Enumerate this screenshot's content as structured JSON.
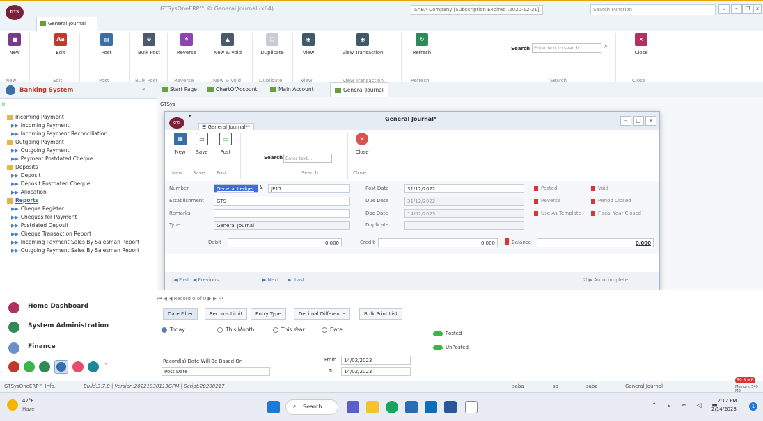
{
  "window": {
    "app_title": "GTSysOneERP™ © General Journal (x64)",
    "company": "SABA Company [Subscription Expired :2020-12-31]",
    "search_function_placeholder": "Search Function",
    "logo_text": "GTS",
    "doc_tab": "General Journal"
  },
  "ribbon": {
    "buttons": [
      {
        "label": "New",
        "group": "New",
        "color": "#7a3a8a"
      },
      {
        "label": "Edit",
        "group": "Edit",
        "color": "#c0392b"
      },
      {
        "label": "Post",
        "group": "Post",
        "color": "#3a6ea5"
      },
      {
        "label": "Bulk Post",
        "group": "Bulk Post",
        "color": "#4a5a6a"
      },
      {
        "label": "Reverse",
        "group": "Reverse",
        "color": "#8e44ad"
      },
      {
        "label": "New & Void",
        "group": "New & Void",
        "color": "#4a5a6a"
      },
      {
        "label": "Duplicate",
        "group": "Duplicate",
        "color": "#c7ccd2"
      },
      {
        "label": "View",
        "group": "View",
        "color": "#3d5a66"
      },
      {
        "label": "View Transaction",
        "group": "View Transaction",
        "color": "#3d5a66"
      },
      {
        "label": "Refresh",
        "group": "Refresh",
        "color": "#2e8b57"
      },
      {
        "label": "Close",
        "group": "Close",
        "color": "#b03060"
      }
    ],
    "search_label": "Search",
    "search_placeholder": "Enter text to search...",
    "search_group": "Search"
  },
  "sidebar": {
    "title": "Banking System",
    "tree": [
      {
        "label": "Incoming Payment",
        "kind": "folder"
      },
      {
        "label": "Incoming Payment",
        "kind": "item"
      },
      {
        "label": "Incoming Payment Reconciliation",
        "kind": "item"
      },
      {
        "label": "Outgoing Payment",
        "kind": "folder"
      },
      {
        "label": "Outgoing Payment",
        "kind": "item"
      },
      {
        "label": "Payment Postdated Cheque",
        "kind": "item"
      },
      {
        "label": "Deposits",
        "kind": "folder"
      },
      {
        "label": "Deposit",
        "kind": "item"
      },
      {
        "label": "Deposit Postdated Cheque",
        "kind": "item"
      },
      {
        "label": "Allocation",
        "kind": "item"
      },
      {
        "label": "Reports",
        "kind": "folder-link"
      },
      {
        "label": "Cheque Register",
        "kind": "item"
      },
      {
        "label": "Cheques for Payment",
        "kind": "item"
      },
      {
        "label": "Postdated Deposit",
        "kind": "item"
      },
      {
        "label": "Cheque Transaction Report",
        "kind": "item"
      },
      {
        "label": "Incoming Payment Sales By Salesman Report",
        "kind": "item"
      },
      {
        "label": "Outgoing Payment Sales By Salesman Report",
        "kind": "item"
      }
    ],
    "nav": [
      {
        "label": "Home Dashboard",
        "color": "#b03060"
      },
      {
        "label": "System Administration",
        "color": "#2e8b57"
      },
      {
        "label": "Finance",
        "color": "#3a6ea5"
      }
    ]
  },
  "tabs": [
    "Start Page",
    "ChartOfAccount",
    "Main Account",
    "General Journal"
  ],
  "breadcrumb": "GTSys",
  "dialog": {
    "title": "General Journal*",
    "tab": "General Journal**",
    "buttons": [
      {
        "label": "New",
        "group": "New"
      },
      {
        "label": "Save",
        "group": "Save"
      },
      {
        "label": "Post",
        "group": "Post"
      },
      {
        "label": "Close",
        "group": "Close"
      }
    ],
    "search_label": "Search",
    "search_placeholder": "Enter text...",
    "search_group": "Search",
    "fields": {
      "number_label": "Number",
      "number_type": "General Ledger N",
      "number_value": "JE17",
      "establishment_label": "Establishment",
      "establishment_value": "GTS",
      "remarks_label": "Remarks",
      "remarks_value": "",
      "type_label": "Type",
      "type_value": "General Journal",
      "post_date_label": "Post Date",
      "post_date_value": "31/12/2022",
      "due_date_label": "Due Date",
      "due_date_value": "31/12/2022",
      "doc_date_label": "Doc Date",
      "doc_date_value": "14/02/2023",
      "duplicate_label": "Duplicate",
      "duplicate_value": ""
    },
    "flags": [
      "Posted",
      "Void",
      "Reverse",
      "Period Closed",
      "Use As Template",
      "Fiscal Year Closed"
    ],
    "totals": {
      "debit_label": "Debit",
      "debit": "0.000",
      "credit_label": "Credit",
      "credit": "0.000",
      "balance_label": "Balance",
      "balance": "0.000"
    },
    "nav": {
      "first": "First",
      "previous": "Previous",
      "next": "Next",
      "last": "Last",
      "autocomplete": "Autocomplete"
    }
  },
  "filters": {
    "record_nav": "Record 0 of 0",
    "tabs": [
      "Date Filter",
      "Records Limit",
      "Entry Type",
      "Decimal Difference",
      "Bulk Print List"
    ],
    "radios": [
      "Today",
      "This Month",
      "This Year",
      "Date"
    ],
    "toggles": [
      "Posted",
      "UnPosted"
    ],
    "based_on_label": "Record(s) Date Will Be Based On",
    "based_on_value": "Post Date",
    "from_label": "From",
    "from_value": "14/02/2023",
    "to_label": "To",
    "to_value": "14/02/2023"
  },
  "statusbar": {
    "info": "GTSysOneERP™ Info.",
    "build": "Build:3.7.8 | Version:20221030113GPM | Script:20200217",
    "items": [
      "saba",
      "sa",
      "saba",
      "General Journal"
    ],
    "memory_badge": "59.8 MB",
    "memory_text": "Memory: 549 MB"
  },
  "taskbar": {
    "weather_temp": "47°F",
    "weather_desc": "Haze",
    "search": "Search",
    "time": "12:12 PM",
    "date": "2/14/2023",
    "notif_count": "1"
  }
}
